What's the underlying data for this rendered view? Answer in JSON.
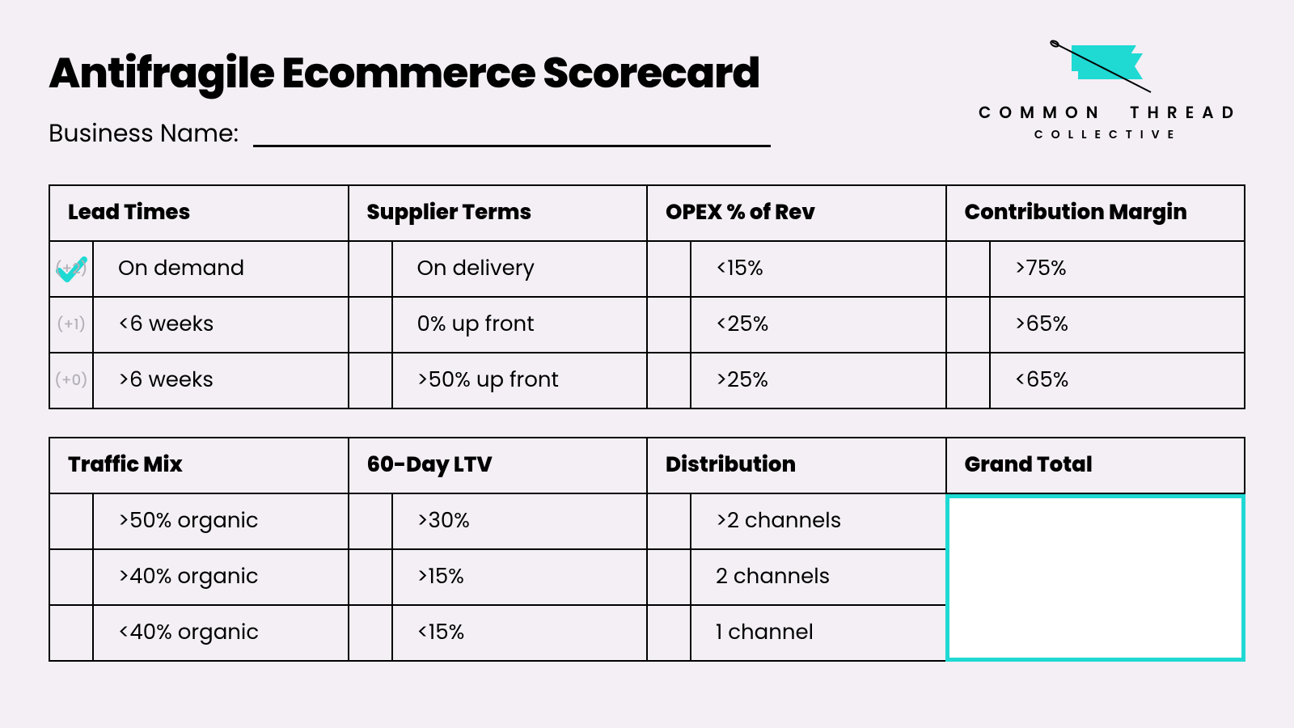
{
  "page_title": "Antifragile Ecommerce Scorecard",
  "business_label": "Business Name:",
  "brand": {
    "line1a": "COMMON",
    "line1b": "THREAD",
    "line2": "COLLECTIVE"
  },
  "score_labels": {
    "plus2": "(+2)",
    "plus1": "(+1)",
    "plus0": "(+0)"
  },
  "cols_top": {
    "lead_times": {
      "header": "Lead Times",
      "r0": "On demand",
      "r1": "<6 weeks",
      "r2": ">6 weeks"
    },
    "supplier_terms": {
      "header": "Supplier Terms",
      "r0": "On delivery",
      "r1": "0% up front",
      "r2": ">50% up front"
    },
    "opex": {
      "header": "OPEX % of Rev",
      "r0": "<15%",
      "r1": "<25%",
      "r2": ">25%"
    },
    "contribution": {
      "header": "Contribution Margin",
      "r0": ">75%",
      "r1": ">65%",
      "r2": "<65%"
    }
  },
  "cols_bottom": {
    "traffic": {
      "header": "Traffic Mix",
      "r0": ">50% organic",
      "r1": ">40% organic",
      "r2": "<40% organic"
    },
    "ltv": {
      "header": "60-Day LTV",
      "r0": ">30%",
      "r1": ">15%",
      "r2": "<15%"
    },
    "distribution": {
      "header": "Distribution",
      "r0": ">2 channels",
      "r1": "2 channels",
      "r2": "1 channel"
    },
    "total": {
      "header": "Grand Total"
    }
  }
}
